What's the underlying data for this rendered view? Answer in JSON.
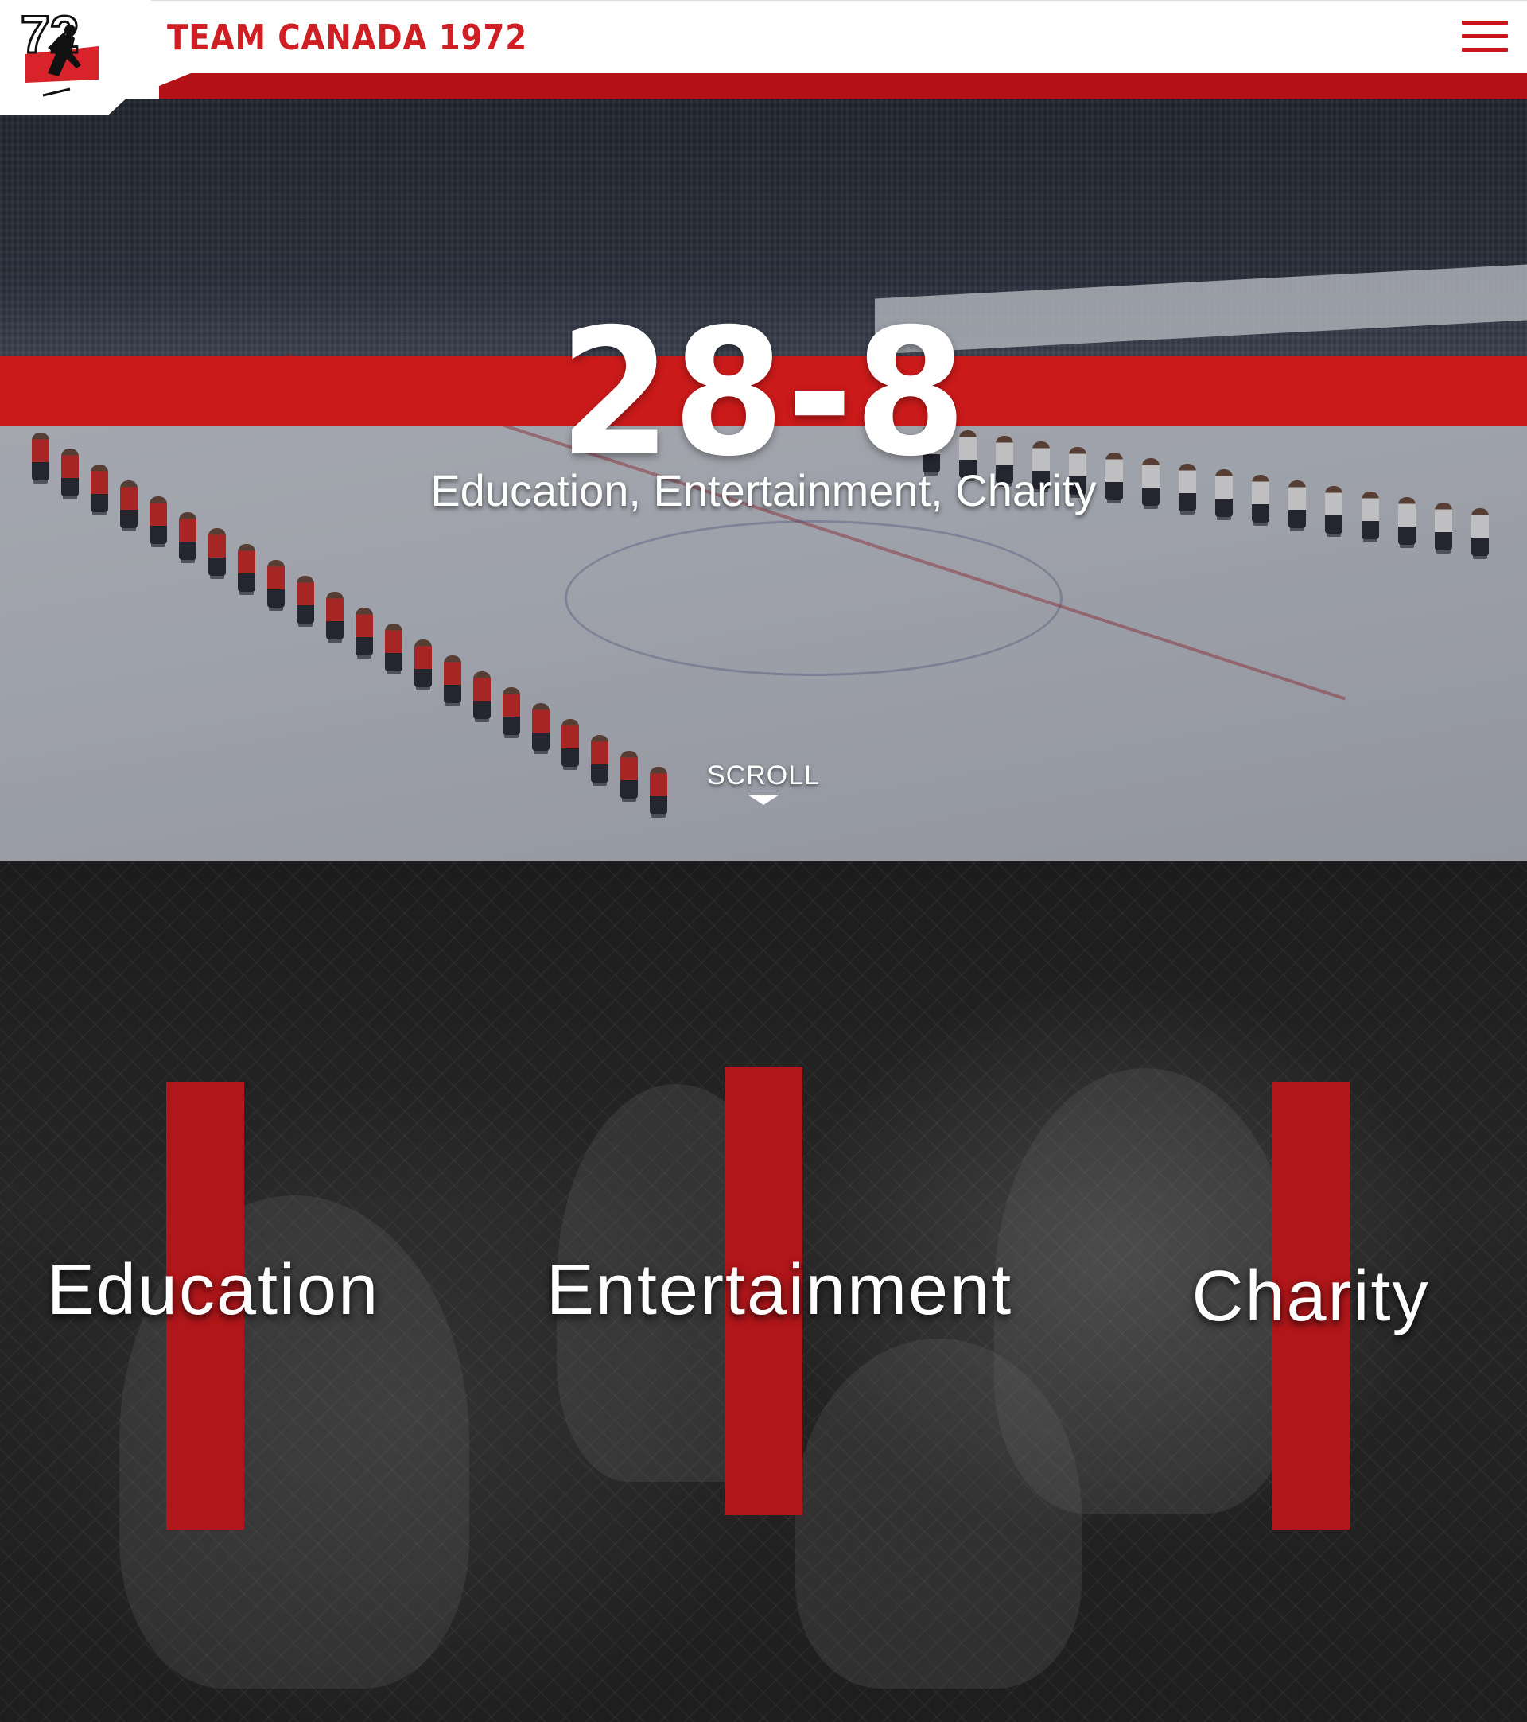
{
  "header": {
    "logo_text": "72",
    "title": "TEAM CANADA 1972",
    "menu_icon": "hamburger-menu-icon"
  },
  "hero": {
    "score": "28-8",
    "subtitle": "Education, Entertainment, Charity",
    "scroll_label": "SCROLL",
    "scroll_icon": "chevron-down-icon"
  },
  "pillars": {
    "items": [
      {
        "label": "Education"
      },
      {
        "label": "Entertainment"
      },
      {
        "label": "Charity"
      }
    ]
  },
  "colors": {
    "brand_red": "#cb1a1a",
    "dark_red": "#b1161a",
    "header_bg": "#ffffff",
    "text_light": "#ffffff"
  }
}
